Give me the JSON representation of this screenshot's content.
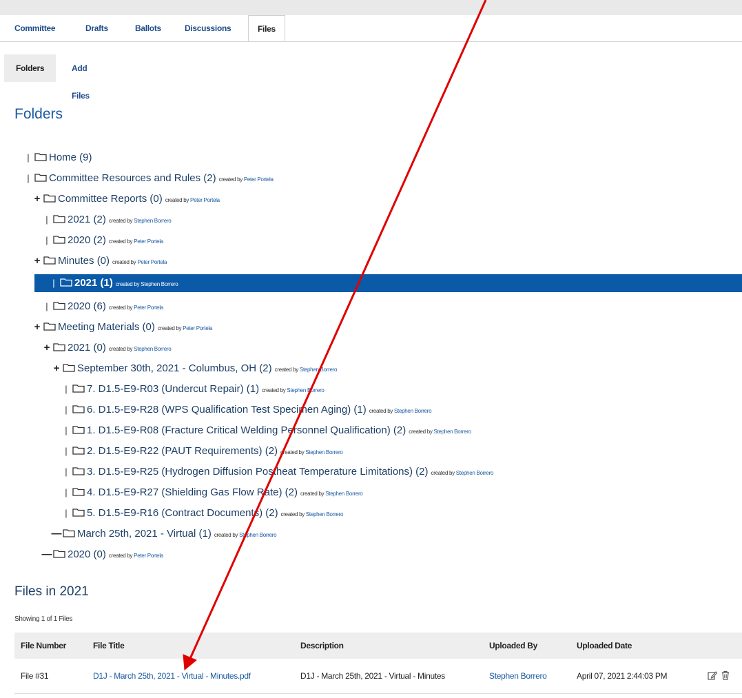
{
  "tabs": [
    "Committee",
    "Drafts",
    "Ballots",
    "Discussions",
    "Files"
  ],
  "subtabs": [
    "Folders",
    "Add Files"
  ],
  "page_title": "Folders",
  "created_by_text": "created by",
  "tree": [
    {
      "mark": "bar",
      "label": "Home (9)",
      "by": ""
    },
    {
      "mark": "bar",
      "label": "Committee Resources and Rules (2)",
      "by": "Peter Portela"
    },
    {
      "mark": "plus",
      "label": "Committee Reports (0)",
      "by": "Peter Portela"
    },
    {
      "mark": "bar",
      "label": "2021 (2)",
      "by": "Stephen Borrero"
    },
    {
      "mark": "bar",
      "label": "2020 (2)",
      "by": "Peter Portela"
    },
    {
      "mark": "plus",
      "label": "Minutes (0)",
      "by": "Peter Portela"
    },
    {
      "mark": "bar",
      "label": "2021 (1)",
      "by": "Stephen Borrero",
      "selected": true
    },
    {
      "mark": "bar",
      "label": "2020 (6)",
      "by": "Peter Portela"
    },
    {
      "mark": "plus",
      "label": "Meeting Materials (0)",
      "by": "Peter Portela"
    },
    {
      "mark": "plus",
      "label": "2021 (0)",
      "by": "Stephen Borrero"
    },
    {
      "mark": "plus",
      "label": "September 30th, 2021 - Columbus, OH (2)",
      "by": "Stephen Borrero"
    },
    {
      "mark": "bar",
      "label": "7. D1.5-E9-R03 (Undercut Repair) (1)",
      "by": "Stephen Borrero"
    },
    {
      "mark": "bar",
      "label": "6. D1.5-E9-R28 (WPS Qualification Test Specimen Aging) (1)",
      "by": "Stephen Borrero"
    },
    {
      "mark": "bar",
      "label": "1. D1.5-E9-R08 (Fracture Critical Welding Personnel Qualification) (2)",
      "by": "Stephen Borrero"
    },
    {
      "mark": "bar",
      "label": "2. D1.5-E9-R22 (PAUT Requirements) (2)",
      "by": "Stephen Borrero"
    },
    {
      "mark": "bar",
      "label": "3. D1.5-E9-R25 (Hydrogen Diffusion Postheat Temperature Limitations) (2)",
      "by": "Stephen Borrero"
    },
    {
      "mark": "bar",
      "label": "4. D1.5-E9-R27 (Shielding Gas Flow Rate) (2)",
      "by": "Stephen Borrero"
    },
    {
      "mark": "bar",
      "label": "5. D1.5-E9-R16 (Contract Documents) (2)",
      "by": "Stephen Borrero"
    },
    {
      "mark": "minus",
      "label": "March 25th, 2021 - Virtual (1)",
      "by": "Stephen Borrero"
    },
    {
      "mark": "minus",
      "label": "2020 (0)",
      "by": "Peter Portela"
    }
  ],
  "files_title": "Files in 2021",
  "showing": "Showing 1 of 1 Files",
  "table": {
    "headers": [
      "File Number",
      "File Title",
      "Description",
      "Uploaded By",
      "Uploaded Date"
    ],
    "rows": [
      {
        "number": "File #31",
        "title": "D1J - March 25th, 2021 - Virtual - Minutes.pdf",
        "description": "D1J - March 25th, 2021 - Virtual - Minutes",
        "uploaded_by": "Stephen Borrero",
        "date": "April 07, 2021 2:44:03 PM"
      }
    ]
  },
  "icons": {
    "folder": "folder-icon",
    "edit": "edit-icon",
    "delete": "trash-icon"
  },
  "colors": {
    "link": "#1a5aa0",
    "selected_row": "#0a5aa8",
    "arrow": "#e00000"
  }
}
